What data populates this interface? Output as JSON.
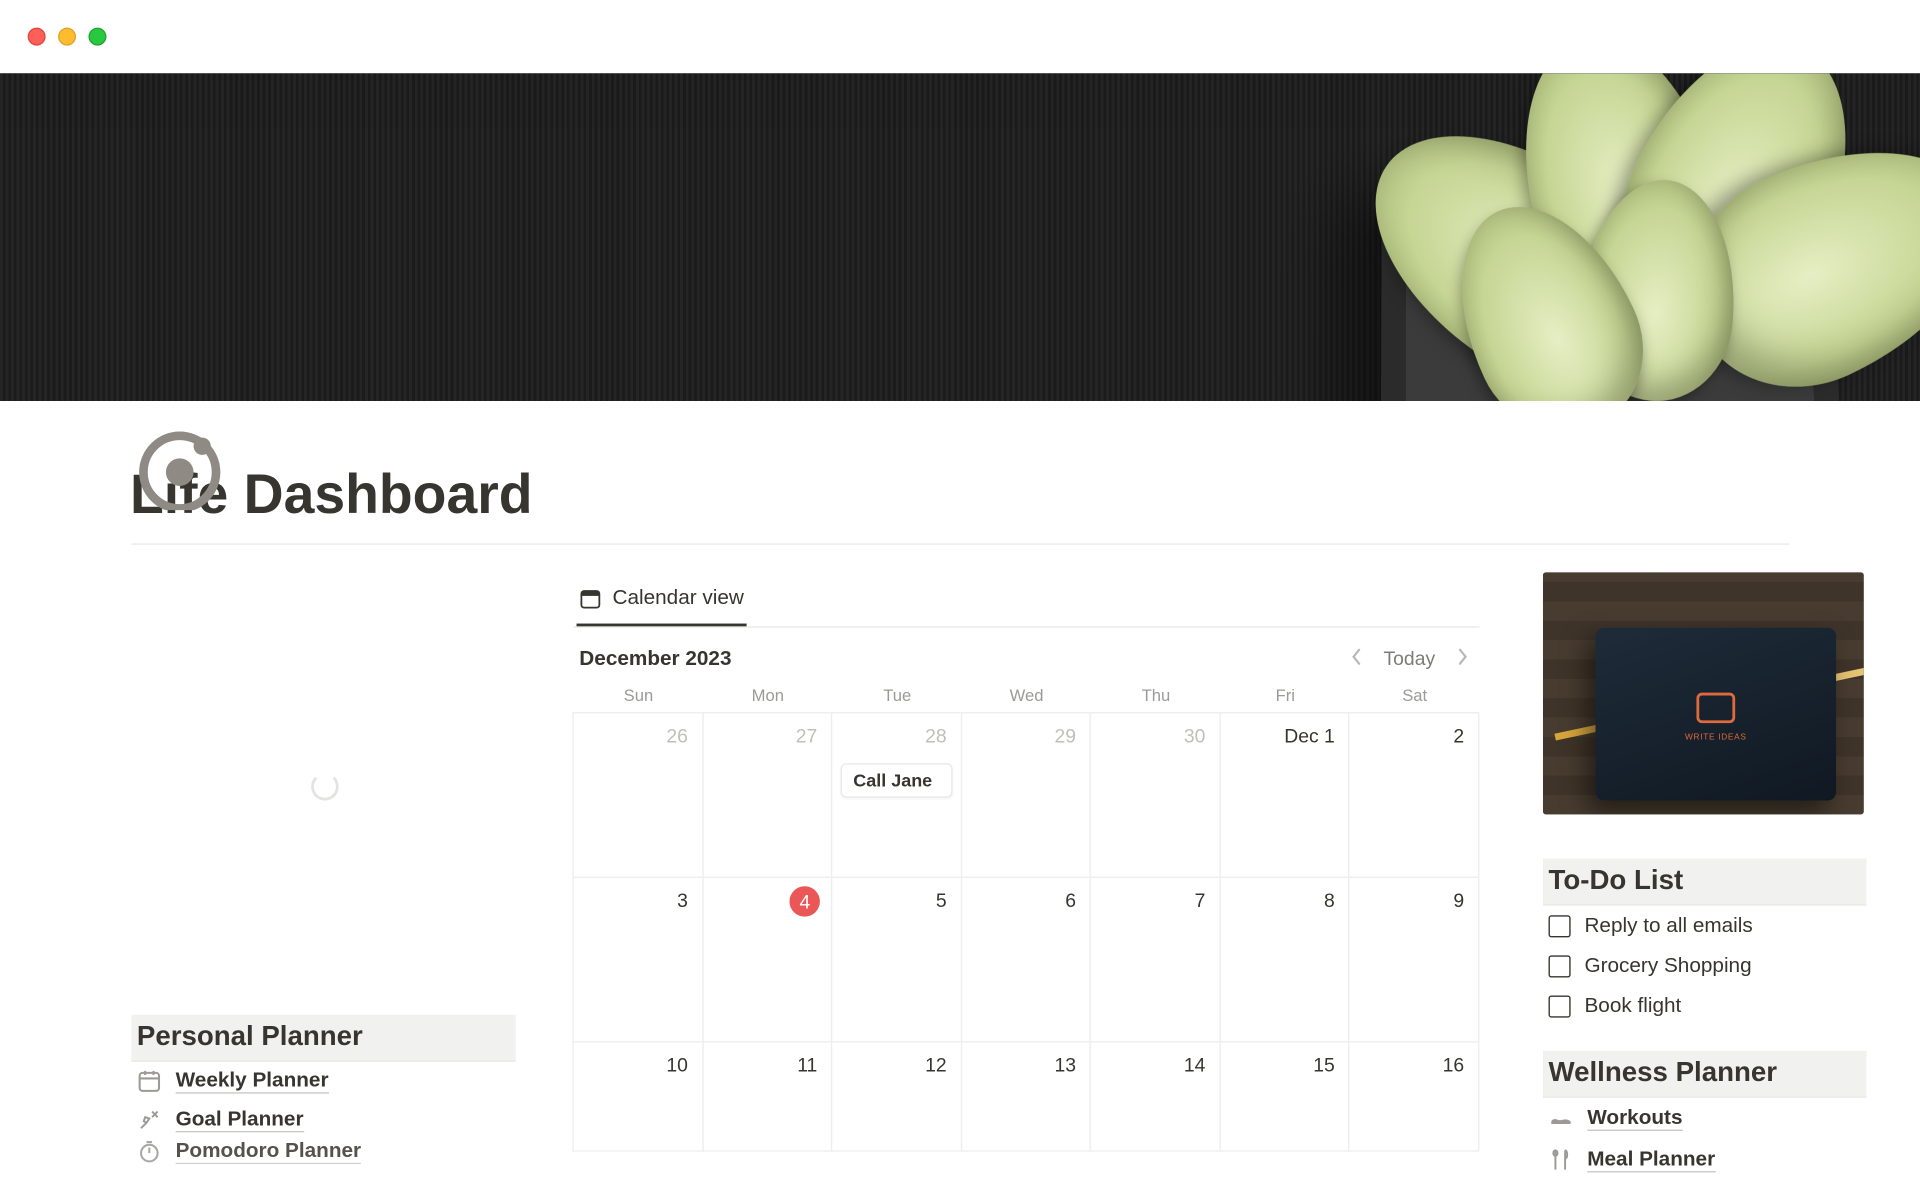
{
  "page": {
    "title": "Life Dashboard"
  },
  "calendar": {
    "tab_label": "Calendar view",
    "month_label": "December 2023",
    "today_label": "Today",
    "dow": [
      "Sun",
      "Mon",
      "Tue",
      "Wed",
      "Thu",
      "Fri",
      "Sat"
    ],
    "cells": [
      {
        "n": "26",
        "dim": true
      },
      {
        "n": "27",
        "dim": true
      },
      {
        "n": "28",
        "dim": true,
        "event": "Call Jane"
      },
      {
        "n": "29",
        "dim": true
      },
      {
        "n": "30",
        "dim": true
      },
      {
        "n": "Dec 1",
        "first": true
      },
      {
        "n": "2"
      },
      {
        "n": "3"
      },
      {
        "n": "4",
        "today": true
      },
      {
        "n": "5"
      },
      {
        "n": "6"
      },
      {
        "n": "7"
      },
      {
        "n": "8"
      },
      {
        "n": "9"
      },
      {
        "n": "10"
      },
      {
        "n": "11"
      },
      {
        "n": "12"
      },
      {
        "n": "13"
      },
      {
        "n": "14"
      },
      {
        "n": "15"
      },
      {
        "n": "16"
      }
    ]
  },
  "left": {
    "heading": "Personal Planner",
    "links": [
      {
        "icon": "calendar",
        "label": "Weekly Planner"
      },
      {
        "icon": "target",
        "label": "Goal Planner"
      },
      {
        "icon": "timer",
        "label": "Pomodoro Planner"
      }
    ]
  },
  "right": {
    "todo_heading": "To-Do List",
    "todos": [
      "Reply to all emails",
      "Grocery Shopping",
      "Book flight"
    ],
    "wellness_heading": "Wellness Planner",
    "wellness_links": [
      {
        "icon": "shoe",
        "label": "Workouts"
      },
      {
        "icon": "utensils",
        "label": "Meal Planner"
      }
    ]
  }
}
